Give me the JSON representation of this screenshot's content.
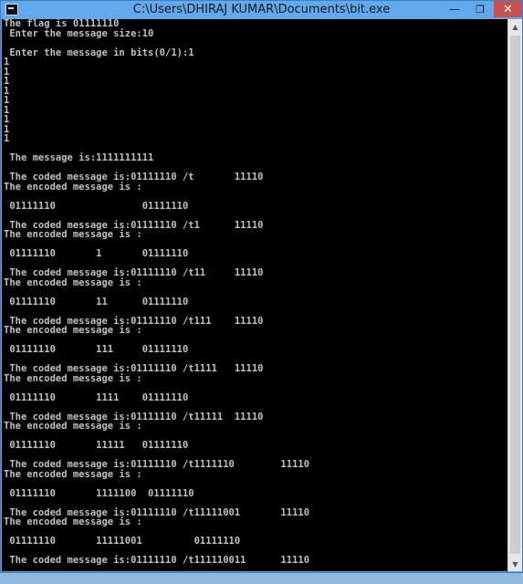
{
  "window": {
    "title": "C:\\Users\\DHIRAJ KUMAR\\Documents\\bit.exe",
    "minimize_glyph": "—",
    "maximize_glyph": "❐",
    "close_glyph": "✕"
  },
  "console": {
    "lines": [
      "The flag is 01111110",
      " Enter the message size:10",
      "",
      " Enter the message in bits(0/1):1",
      "1",
      "1",
      "1",
      "1",
      "1",
      "1",
      "1",
      "1",
      "1",
      "",
      " The message is:1111111111",
      "",
      " The coded message is:01111110 /t       11110",
      "The encoded message is :",
      "",
      " 01111110               01111110",
      "",
      " The coded message is:01111110 /t1      11110",
      "The encoded message is :",
      "",
      " 01111110       1       01111110",
      "",
      " The coded message is:01111110 /t11     11110",
      "The encoded message is :",
      "",
      " 01111110       11      01111110",
      "",
      " The coded message is:01111110 /t111    11110",
      "The encoded message is :",
      "",
      " 01111110       111     01111110",
      "",
      " The coded message is:01111110 /t1111   11110",
      "The encoded message is :",
      "",
      " 01111110       1111    01111110",
      "",
      " The coded message is:01111110 /t11111  11110",
      "The encoded message is :",
      "",
      " 01111110       11111   01111110",
      "",
      " The coded message is:01111110 /t1111110        11110",
      "The encoded message is :",
      "",
      " 01111110       1111100  01111110",
      "",
      " The coded message is:01111110 /t11111001       11110",
      "The encoded message is :",
      "",
      " 01111110       11111001         01111110",
      "",
      " The coded message is:01111110 /t111110011      11110"
    ]
  }
}
